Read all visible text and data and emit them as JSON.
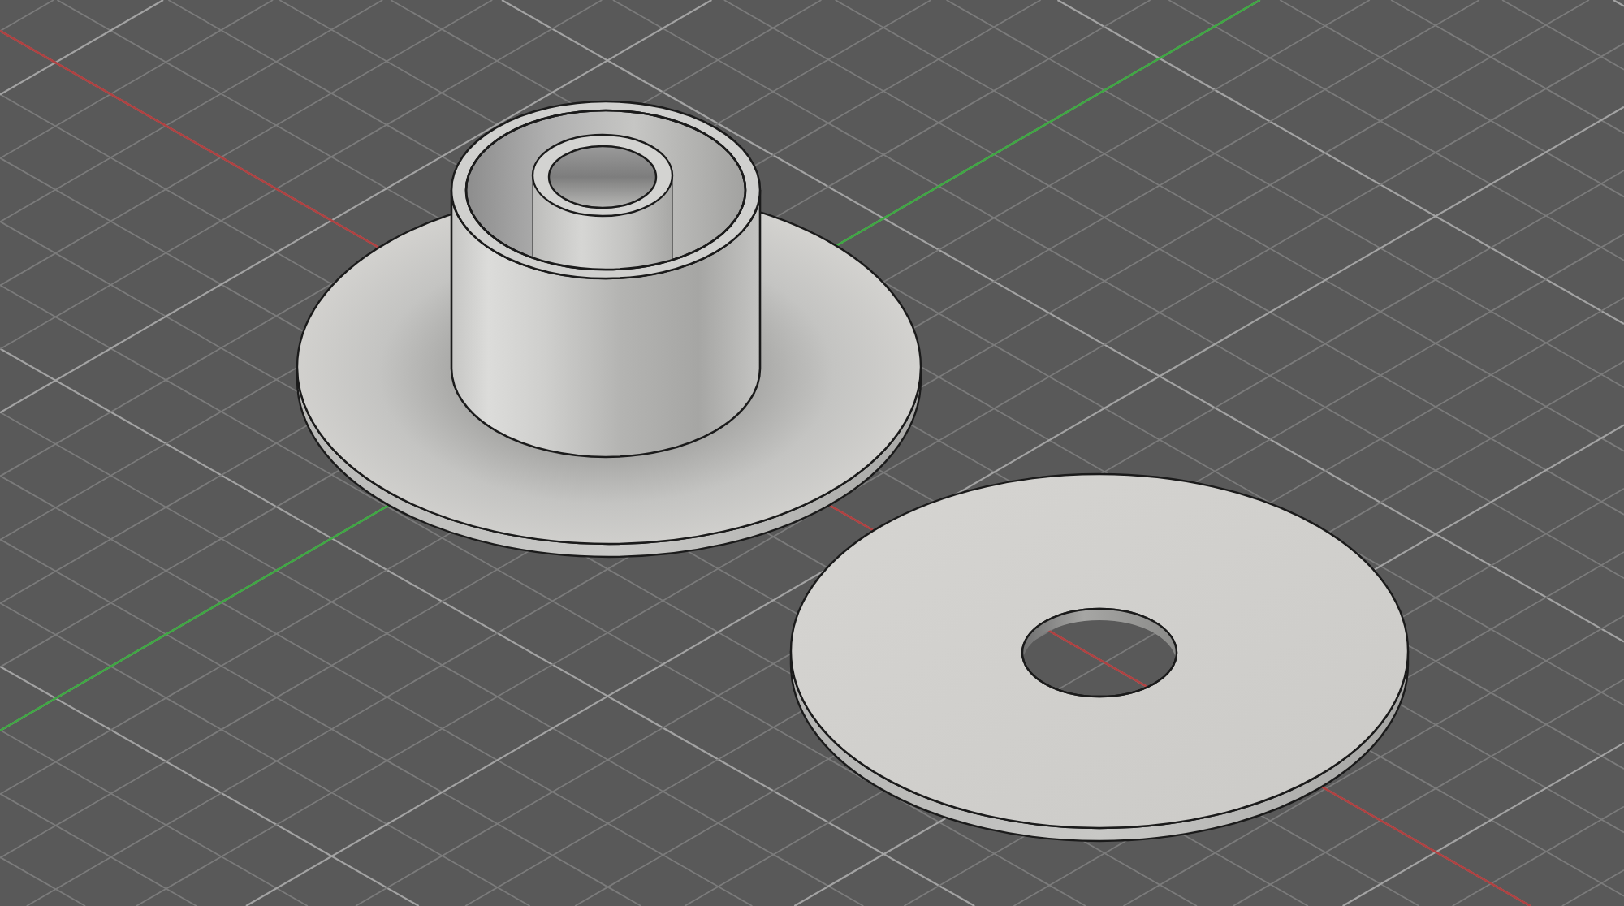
{
  "viewport": {
    "axes": [
      {
        "kind": "x",
        "color": "#b04141"
      },
      {
        "kind": "y",
        "color": "#3fa843"
      }
    ],
    "models": [
      {
        "kind": "flanged-hub"
      },
      {
        "kind": "washer"
      }
    ]
  }
}
